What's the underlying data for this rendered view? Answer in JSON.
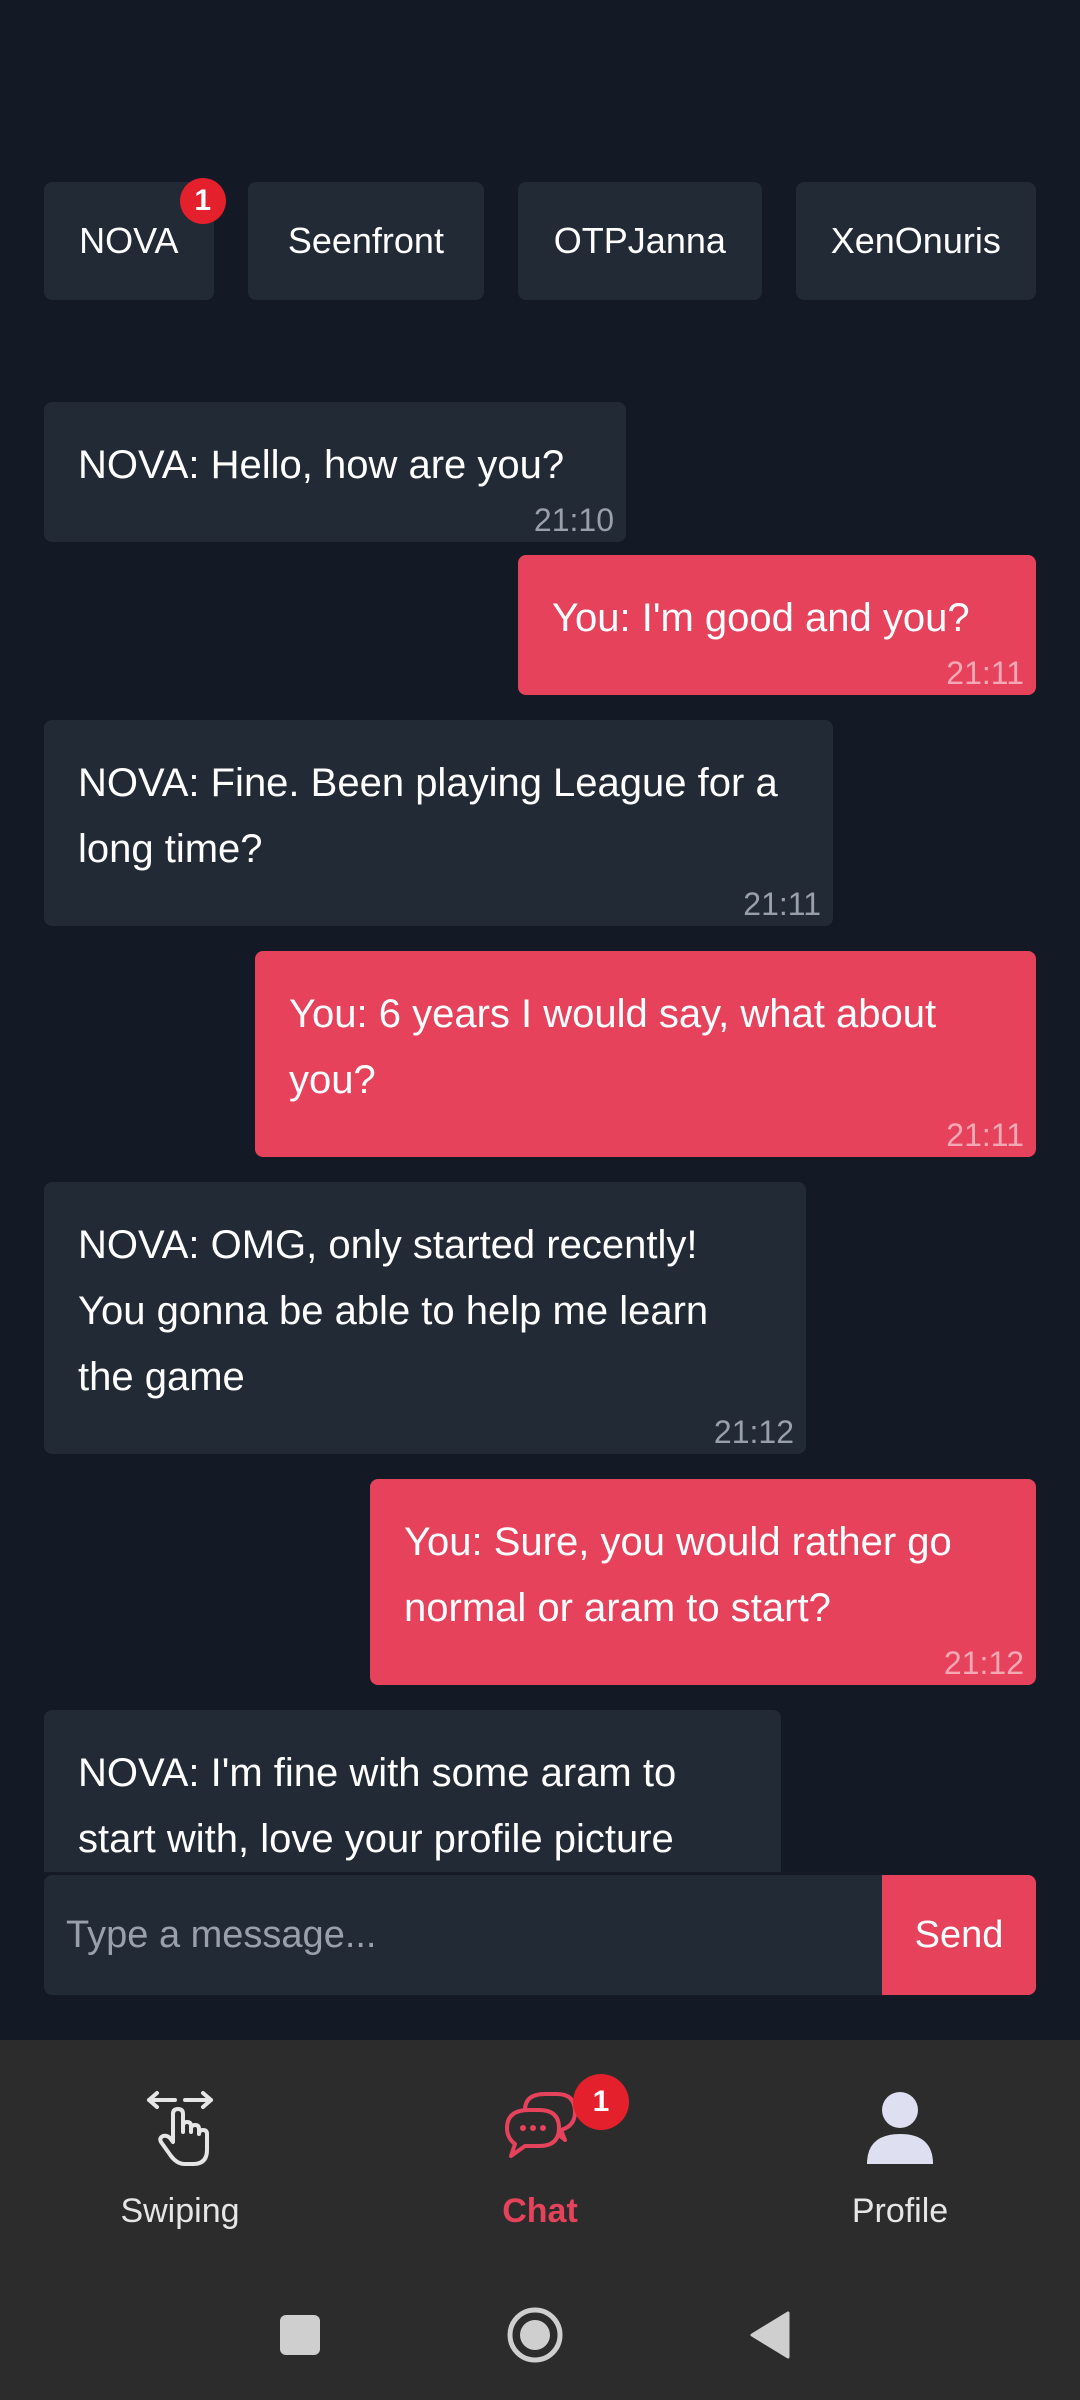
{
  "tabs": [
    {
      "label": "NOVA",
      "badge": "1"
    },
    {
      "label": "Seenfront"
    },
    {
      "label": "OTPJanna"
    },
    {
      "label": "XenOnuris"
    }
  ],
  "messages": [
    {
      "from": "in",
      "text": "NOVA: Hello, how are you?",
      "time": "21:10"
    },
    {
      "from": "out",
      "text": "You: I'm good and you?",
      "time": "21:11"
    },
    {
      "from": "in",
      "text": "NOVA: Fine. Been playing League for a long time?",
      "time": "21:11"
    },
    {
      "from": "out",
      "text": "You: 6 years I would say, what about you?",
      "time": "21:11"
    },
    {
      "from": "in",
      "text": "NOVA: OMG, only started recently! You gonna be able to help me learn the game",
      "time": "21:12"
    },
    {
      "from": "out",
      "text": "You: Sure, you would rather go normal or aram to start?",
      "time": "21:12"
    },
    {
      "from": "in",
      "text": "NOVA: I'm fine with some aram to start with, love your profile picture",
      "time": ""
    }
  ],
  "composer": {
    "placeholder": "Type a message...",
    "send_label": "Send"
  },
  "nav": {
    "swiping": {
      "label": "Swiping",
      "icon": "swipe-hand-icon"
    },
    "chat": {
      "label": "Chat",
      "icon": "chat-bubbles-icon",
      "badge": "1"
    },
    "profile": {
      "label": "Profile",
      "icon": "person-icon"
    }
  },
  "colors": {
    "background": "#131a25",
    "card": "#222a36",
    "accent": "#e6425c",
    "badge": "#e3202b",
    "nav_bar": "#2c2c2c"
  }
}
